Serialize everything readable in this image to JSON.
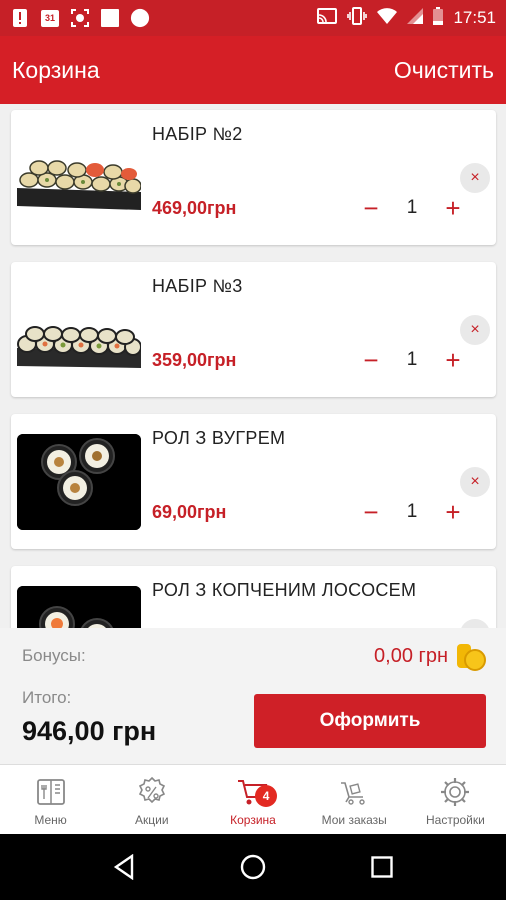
{
  "status_bar": {
    "time": "17:51",
    "calendar_day": "31",
    "icons": [
      "alert-icon",
      "calendar-icon",
      "screenshot-icon",
      "square-icon",
      "circle-icon",
      "cast-icon",
      "vibrate-icon",
      "wifi-icon",
      "signal-icon",
      "battery-icon"
    ]
  },
  "app_bar": {
    "title": "Корзина",
    "clear_label": "Очистить"
  },
  "cart": {
    "items": [
      {
        "name": "НАБІР №2",
        "price": "469,00грн",
        "quantity": "1",
        "remove": "×"
      },
      {
        "name": "НАБІР №3",
        "price": "359,00грн",
        "quantity": "1",
        "remove": "×"
      },
      {
        "name": "РОЛ З ВУГРЕМ",
        "price": "69,00грн",
        "quantity": "1",
        "remove": "×"
      },
      {
        "name": "РОЛ З КОПЧЕНИМ ЛОСОСЕМ",
        "price": "",
        "quantity": "",
        "remove": ""
      }
    ],
    "minus": "−",
    "plus": "+"
  },
  "summary": {
    "bonus_label": "Бонусы:",
    "bonus_value": "0,00 грн",
    "total_label": "Итого:",
    "total_value": "946,00 грн",
    "checkout_label": "Оформить"
  },
  "tabs": [
    {
      "label": "Меню",
      "icon": "menu-book-icon"
    },
    {
      "label": "Акции",
      "icon": "percent-badge-icon"
    },
    {
      "label": "Корзина",
      "icon": "cart-icon",
      "badge": "4",
      "active": true
    },
    {
      "label": "Мои заказы",
      "icon": "orders-cart-icon"
    },
    {
      "label": "Настройки",
      "icon": "gear-icon"
    }
  ],
  "colors": {
    "brand_red": "#d51f26",
    "price_red": "#c62027",
    "coin_yellow": "#f2b705"
  }
}
